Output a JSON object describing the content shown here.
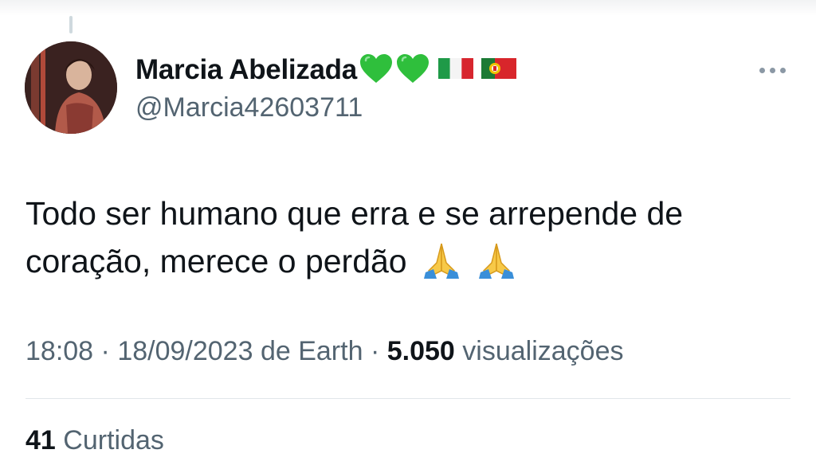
{
  "tweet": {
    "display_name": "Marcia Abelizada",
    "name_emojis": [
      "green-heart",
      "green-heart",
      "flag-italy",
      "flag-portugal"
    ],
    "handle": "@Marcia42603711",
    "text_line1": "Todo ser humano que erra e se arrepende de",
    "text_line2": "coração, merece o perdão",
    "text_emojis": [
      "folded-hands",
      "folded-hands"
    ],
    "time": "18:08",
    "date": "18/09/2023",
    "source": "de Earth",
    "separator": "·",
    "views_count": "5.050",
    "views_label": "visualizações",
    "likes_count": "41",
    "likes_label": "Curtidas"
  },
  "colors": {
    "text_primary": "#0f1419",
    "text_secondary": "#536471",
    "heart_green": "#2fbf3c",
    "divider": "#e1e6ea"
  }
}
